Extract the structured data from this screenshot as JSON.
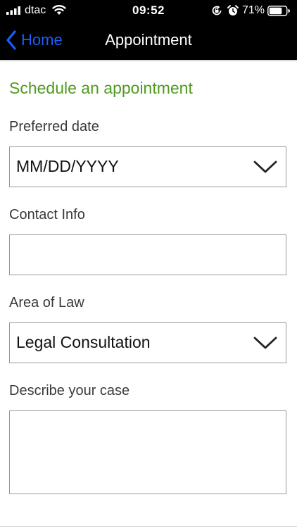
{
  "status_bar": {
    "carrier": "dtac",
    "time": "09:52",
    "battery_percent": "71%"
  },
  "nav": {
    "back_label": "Home",
    "title": "Appointment"
  },
  "form": {
    "section_title": "Schedule an appointment",
    "preferred_date": {
      "label": "Preferred date",
      "placeholder": "MM/DD/YYYY"
    },
    "contact_info": {
      "label": "Contact Info",
      "value": ""
    },
    "area_of_law": {
      "label": "Area of Law",
      "selected": "Legal Consultation"
    },
    "case_description": {
      "label": "Describe your case",
      "value": ""
    }
  },
  "colors": {
    "header_bg": "#000000",
    "back_link": "#1a5cff",
    "section_title": "#4f9a1f"
  },
  "icons": [
    "signal-bars-icon",
    "wifi-icon",
    "rotation-lock-icon",
    "alarm-clock-icon",
    "battery-icon",
    "chevron-left-icon",
    "chevron-down-icon"
  ]
}
